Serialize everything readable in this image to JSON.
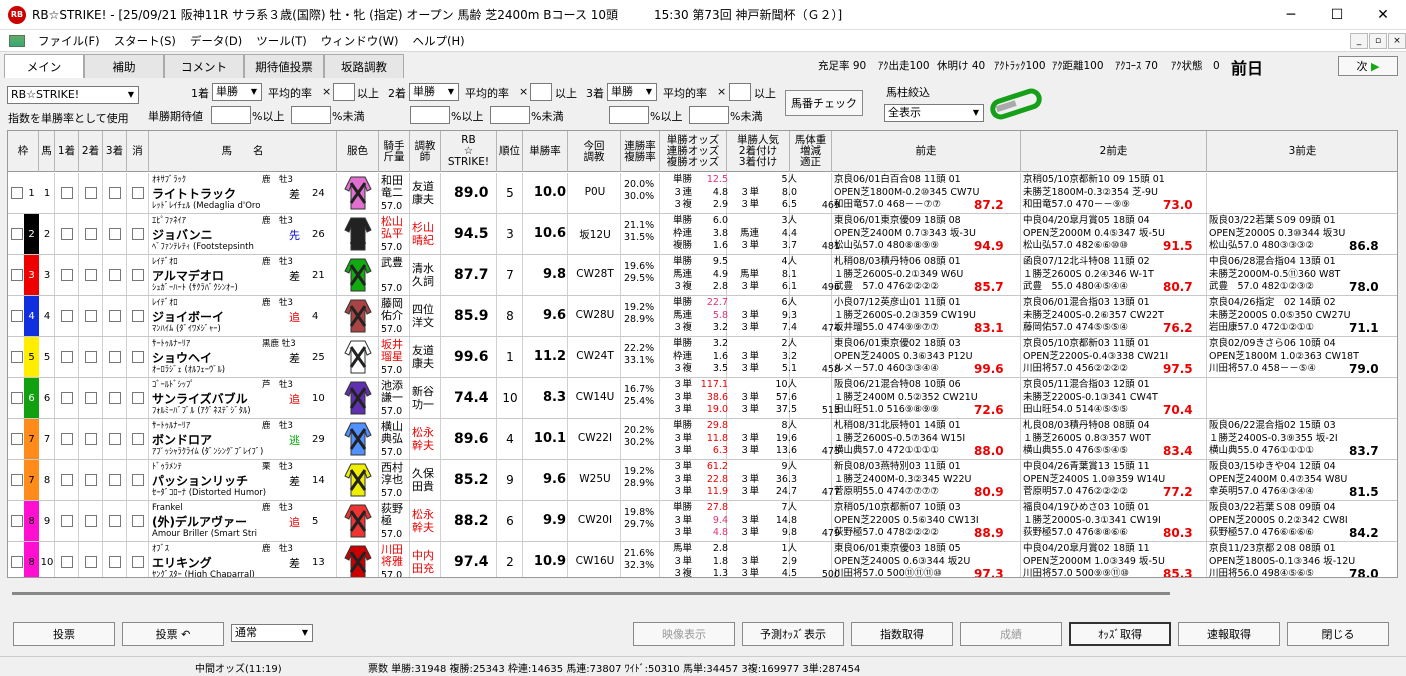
{
  "window": {
    "title": "RB☆STRIKE! - [25/09/21 阪神11R サラ系３歳(国際) 牡・牝 (指定) オープン 馬齢 芝2400m Bコース 10頭　　　15:30 第73回 神戸新聞杯（Ｇ２）]",
    "logo": "RB",
    "min": "─",
    "max": "☐",
    "close": "✕"
  },
  "menu": [
    "ファイル(F)",
    "スタート(S)",
    "データ(D)",
    "ツール(T)",
    "ウィンドウ(W)",
    "ヘルプ(H)"
  ],
  "mdi": [
    "_",
    "▫",
    "×"
  ],
  "tabs": [
    "メイン",
    "補助",
    "コメント",
    "期待値投票",
    "坂路調教"
  ],
  "stats": [
    "充足率 90",
    "ｱｸ出走100",
    "休明け 40",
    "ｱｸﾄﾗｯｸ100",
    "ｱｸ距離100",
    "ｱｸｺｰｽ 70",
    "ｱｸ状態　0"
  ],
  "today": "前日",
  "next": "次",
  "controls": {
    "index_select": "RB☆STRIKE!",
    "use_label": "指数を単勝率として使用",
    "first": "1着",
    "second": "2着",
    "third": "3着",
    "bet": "単勝",
    "avg": "平均的率",
    "mul": "×",
    "above": "以上",
    "pctAbove": "%以上",
    "pctBelow": "%未満",
    "expect": "単勝期待値",
    "baban": "馬番チェック",
    "filter_label": "馬柱絞込",
    "filter_value": "全表示"
  },
  "headers": [
    "枠",
    "馬",
    "1着",
    "2着",
    "3着",
    "消",
    "馬　　名",
    "服色",
    "騎手\n斤量",
    "調教\n師",
    "RB\n☆\nSTRIKE!",
    "順位",
    "単勝率",
    "今回\n調教",
    "連勝率\n複勝率",
    "単勝オッズ\n連勝オッズ\n複勝オッズ",
    "単勝人気\n2着付け\n3着付け",
    "馬体重\n増減\n適正",
    "前走",
    "2前走",
    "3前走"
  ],
  "horses": [
    {
      "waku": "1",
      "wc": "#fff",
      "wt": "#000",
      "no": "1",
      "sire": "ｵｷｻﾌﾞﾗｯｸ",
      "sex": "鹿　牡3",
      "name": "ライトトラック",
      "style": "差",
      "sc": "#000",
      "gate": "24",
      "dam": "ﾚｯﾄﾞﾚｲﾁｪﾙ (Medaglia d'Oro",
      "j1": "和田",
      "j2": "竜二",
      "jc": "#000",
      "w": "57.0",
      "t1": "友道",
      "t2": "康夫",
      "tc": "#000",
      "score": "89.0",
      "rank": "5",
      "win": "10.0",
      "train": "P0U",
      "r1": "20.0%",
      "r2": "30.0%",
      "o": [
        [
          "単勝",
          "12.5",
          "pink"
        ],
        [
          "３連",
          "4.8",
          ""
        ],
        [
          "３複",
          "2.9",
          ""
        ]
      ],
      "p": [
        [
          "",
          "5人"
        ],
        [
          "３単",
          "8.0"
        ],
        [
          "３単",
          "6.5"
        ]
      ],
      "bw": "469",
      "races": [
        [
          "京良06/01白百合08 11頭 01",
          "OPEN芝1800M-0.2⑩345 CW7U",
          "和田竜57.0 468－－⑦⑦ ",
          "87.2"
        ],
        [
          "京稍05/10京都新10 09 15頭 01",
          "未勝芝1800M-0.3②354 芝-9U",
          "和田竜57.0 470－－⑨⑨ ",
          "73.0"
        ],
        null
      ]
    },
    {
      "waku": "2",
      "wc": "#000",
      "wt": "#fff",
      "no": "2",
      "sire": "ｴﾋﾟﾌｧﾈｲｱ",
      "sex": "鹿　牡3",
      "name": "ジョバンニ",
      "style": "先",
      "sc": "#00c",
      "gate": "26",
      "dam": "ﾍﾞﾌｧﾝﾃﾚﾃｨ (Footstepsinth",
      "j1": "松山",
      "j2": "弘平",
      "jc": "#e00",
      "w": "57.0",
      "t1": "杉山",
      "t2": "晴紀",
      "tc": "#e00",
      "score": "94.5",
      "rank": "3",
      "win": "10.6",
      "train": "坂12U",
      "r1": "21.1%",
      "r2": "31.5%",
      "o": [
        [
          "単勝",
          "6.0",
          ""
        ],
        [
          "枠連",
          "3.8",
          ""
        ],
        [
          "複勝",
          "1.6",
          ""
        ]
      ],
      "p": [
        [
          "",
          "3人"
        ],
        [
          "馬連",
          "4.4"
        ],
        [
          "３単",
          "3.7"
        ]
      ],
      "bw": "481",
      "races": [
        [
          "東良06/01東京優09 18頭 08",
          "OPEN芝2400M 0.7③343 坂-3U",
          "松山弘57.0 480⑧⑧⑨⑨ ",
          "94.9"
        ],
        [
          "中良04/20皐月賞05 18頭 04",
          "OPEN芝2000M 0.4⑤347 坂-5U",
          "松山弘57.0 482⑥⑥⑩⑩ ",
          "91.5"
        ],
        [
          "阪良03/22若葉Ｓ09 09頭 01",
          "OPEN芝2000S 0.3⑩344 坂3U",
          "松山弘57.0 480③③③② ",
          "86.8"
        ]
      ]
    },
    {
      "waku": "3",
      "wc": "#e00",
      "wt": "#fff",
      "no": "3",
      "sire": "ﾚｲﾃﾞｵﾛ",
      "sex": "鹿　牡3",
      "name": "アルマデオロ",
      "style": "差",
      "sc": "#000",
      "gate": "21",
      "dam": "ｼｭｶﾞｰﾊｰﾄ (ｻｸﾗﾊﾞｸｼﾝｵｰ)",
      "j1": "武豊",
      "j2": "",
      "jc": "#000",
      "w": "57.0",
      "t1": "清水",
      "t2": "久詞",
      "tc": "#000",
      "score": "87.7",
      "rank": "7",
      "win": "9.8",
      "train": "CW28T",
      "r1": "19.6%",
      "r2": "29.5%",
      "o": [
        [
          "単勝",
          "9.5",
          ""
        ],
        [
          "馬連",
          "4.9",
          ""
        ],
        [
          "３複",
          "2.8",
          ""
        ]
      ],
      "p": [
        [
          "",
          "4人"
        ],
        [
          "馬単",
          "8.1"
        ],
        [
          "３単",
          "6.1"
        ]
      ],
      "bw": "496",
      "races": [
        [
          "札稍08/03積丹特06 08頭 01",
          "１勝芝2600S-0.2①349 W6U",
          "武豊　57.0 476②②②② ",
          "85.7"
        ],
        [
          "函良07/12北斗特08 11頭 02",
          "１勝芝2600S 0.2④346 W-1T",
          "武豊　55.0 480④⑤④④ ",
          "80.7"
        ],
        [
          "中良06/28混合指04 13頭 01",
          "未勝芝2000M-0.5⑪360 W8T",
          "武豊　57.0 482①②③② ",
          "78.0"
        ]
      ]
    },
    {
      "waku": "4",
      "wc": "#1030e0",
      "wt": "#fff",
      "no": "4",
      "sire": "ﾚｲﾃﾞｵﾛ",
      "sex": "鹿　牡3",
      "name": "ジョイボーイ",
      "style": "追",
      "sc": "#e00",
      "gate": "4",
      "dam": "ﾏﾝﾊｲﾑ (ﾀﾞｲﾜﾒｼﾞｬｰ)",
      "j1": "藤岡",
      "j2": "佑介",
      "jc": "#000",
      "w": "57.0",
      "t1": "四位",
      "t2": "洋文",
      "tc": "#000",
      "score": "85.9",
      "rank": "8",
      "win": "9.6",
      "train": "CW28U",
      "r1": "19.2%",
      "r2": "28.9%",
      "o": [
        [
          "単勝",
          "22.7",
          "pink"
        ],
        [
          "馬連",
          "5.8",
          "pink"
        ],
        [
          "３複",
          "3.2",
          ""
        ]
      ],
      "p": [
        [
          "",
          "6人"
        ],
        [
          "３単",
          "9.3"
        ],
        [
          "３単",
          "7.4"
        ]
      ],
      "bw": "474",
      "races": [
        [
          "小良07/12英彦山01 11頭 01",
          "１勝芝2600S-0.2③359 CW19U",
          "坂井瑠55.0 474⑨⑨⑦⑦ ",
          "83.1"
        ],
        [
          "京良06/01混合指03 13頭 01",
          "未勝芝2400S-0.2⑥357 CW22T",
          "藤岡佑57.0 474⑤⑤⑤④ ",
          "76.2"
        ],
        [
          "京良04/26指定　02 14頭 02",
          "未勝芝2000S 0.0⑤350 CW27U",
          "岩田康57.0 472①②①① ",
          "71.1"
        ]
      ]
    },
    {
      "waku": "5",
      "wc": "#ffee00",
      "wt": "#000",
      "no": "5",
      "sire": "ｻｰﾄｩﾙﾅｰﾘｱ",
      "sex": "黒鹿 牡3",
      "name": "ショウヘイ",
      "style": "差",
      "sc": "#000",
      "gate": "25",
      "dam": "ｵｰﾛﾗｼﾞｪ (ｵﾙﾌｪｰｳﾞﾙ)",
      "j1": "坂井",
      "j2": "瑠星",
      "jc": "#e00",
      "w": "57.0",
      "t1": "友道",
      "t2": "康夫",
      "tc": "#000",
      "score": "99.6",
      "rank": "1",
      "win": "11.2",
      "train": "CW24T",
      "r1": "22.2%",
      "r2": "33.1%",
      "o": [
        [
          "単勝",
          "3.2",
          ""
        ],
        [
          "枠連",
          "1.6",
          ""
        ],
        [
          "３複",
          "3.5",
          ""
        ]
      ],
      "p": [
        [
          "",
          "2人"
        ],
        [
          "３単",
          "3.2"
        ],
        [
          "３単",
          "5.1"
        ]
      ],
      "bw": "458",
      "races": [
        [
          "東良06/01東京優02 18頭 03",
          "OPEN芝2400S 0.3⑥343 P12U",
          "ルメ－57.0 460③③④④ ",
          "99.6"
        ],
        [
          "京良05/10京都新03 11頭 01",
          "OPEN芝2200S-0.4③338 CW21I",
          "川田将57.0 456②②②② ",
          "97.5"
        ],
        [
          "京良02/09きさら06 10頭 04",
          "OPEN芝1800M 1.0②363 CW18T",
          "川田将57.0 458－－⑤④ ",
          "79.0"
        ]
      ]
    },
    {
      "waku": "6",
      "wc": "#10a010",
      "wt": "#fff",
      "no": "6",
      "sire": "ｺﾞｰﾙﾄﾞｼｯﾌﾟ",
      "sex": "芦　牡3",
      "name": "サンライズバブル",
      "style": "追",
      "sc": "#e00",
      "gate": "10",
      "dam": "ﾌｫﾙﾐｰﾊﾞﾌﾞﾙ (ｱｸﾞﾈｽﾃﾞｼﾞﾀﾙ)",
      "j1": "池添",
      "j2": "謙一",
      "jc": "#000",
      "w": "57.0",
      "t1": "新谷",
      "t2": "功一",
      "tc": "#000",
      "score": "74.4",
      "rank": "10",
      "win": "8.3",
      "train": "CW14U",
      "r1": "16.7%",
      "r2": "25.4%",
      "o": [
        [
          "３単",
          "117.1",
          "red"
        ],
        [
          "３単",
          "38.6",
          "red"
        ],
        [
          "３単",
          "19.0",
          "red"
        ]
      ],
      "p": [
        [
          "",
          "10人"
        ],
        [
          "３単",
          "57.6"
        ],
        [
          "３単",
          "37.5"
        ]
      ],
      "bw": "513",
      "races": [
        [
          "阪良06/21混合特08 10頭 06",
          "１勝芝2400M 0.5②352 CW21U",
          "田山旺51.0 516⑨⑧⑨⑨ ",
          "72.6"
        ],
        [
          "京良05/11混合指03 12頭 01",
          "未勝芝2200S-0.1③341 CW4T",
          "田山旺54.0 514④⑤⑤⑤ ",
          "70.4"
        ],
        null
      ]
    },
    {
      "waku": "7",
      "wc": "#ff8c1a",
      "wt": "#000",
      "no": "7",
      "sire": "ｻｰﾄｩﾙﾅｰﾘｱ",
      "sex": "鹿　牡3",
      "name": "ボンドロア",
      "style": "逃",
      "sc": "#0a0",
      "gate": "29",
      "dam": "ｱﾌﾟｯｼｬﾗｸﾗｲﾑ (ﾀﾞﾝｼﾝｸﾞﾌﾞﾚｲﾌﾞ)",
      "j1": "横山",
      "j2": "典弘",
      "jc": "#000",
      "w": "57.0",
      "t1": "松永",
      "t2": "幹夫",
      "tc": "#e00",
      "score": "89.6",
      "rank": "4",
      "win": "10.1",
      "train": "CW22I",
      "r1": "20.2%",
      "r2": "30.2%",
      "o": [
        [
          "単勝",
          "29.8",
          "red"
        ],
        [
          "３単",
          "11.8",
          "red"
        ],
        [
          "３単",
          "6.3",
          "red"
        ]
      ],
      "p": [
        [
          "",
          "8人"
        ],
        [
          "３単",
          "19.6"
        ],
        [
          "３単",
          "13.6"
        ]
      ],
      "bw": "473",
      "races": [
        [
          "札稍08/31北辰特01 14頭 01",
          "１勝芝2600S-0.5⑦364 W15I",
          "横山典57.0 472①①①① ",
          "88.0"
        ],
        [
          "札良08/03積丹特08 08頭 04",
          "１勝芝2600S 0.8③357 W0T",
          "横山典55.0 476⑤⑤④⑤ ",
          "83.4"
        ],
        [
          "阪良06/22混合指02 15頭 03",
          "１勝芝2400S-0.3⑨355 坂-2I",
          "横山典55.0 476①①①① ",
          "83.7"
        ]
      ]
    },
    {
      "waku": "7",
      "wc": "#ff8c1a",
      "wt": "#000",
      "no": "8",
      "sire": "ﾄﾞｩﾗﾒﾝﾃ",
      "sex": "栗　牡3",
      "name": "パッションリッチ",
      "style": "差",
      "sc": "#000",
      "gate": "14",
      "dam": "ｾｰﾀﾞｺﾛｰﾅ (Distorted Humor)",
      "j1": "西村",
      "j2": "淳也",
      "jc": "#000",
      "w": "57.0",
      "t1": "久保",
      "t2": "田貴",
      "tc": "#000",
      "score": "85.2",
      "rank": "9",
      "win": "9.6",
      "train": "W25U",
      "r1": "19.2%",
      "r2": "28.9%",
      "o": [
        [
          "３単",
          "61.2",
          "red"
        ],
        [
          "３単",
          "22.8",
          "red"
        ],
        [
          "３単",
          "11.9",
          "red"
        ]
      ],
      "p": [
        [
          "",
          "9人"
        ],
        [
          "３単",
          "36.3"
        ],
        [
          "３単",
          "24.7"
        ]
      ],
      "bw": "477",
      "races": [
        [
          "新良08/03燕特別03 11頭 01",
          "１勝芝2400M-0.3②345 W22U",
          "菅原明55.0 474⑦⑦⑦⑦ ",
          "80.9"
        ],
        [
          "中良04/26青葉賞13 15頭 11",
          "OPEN芝2400S 1.0⑩359 W14U",
          "菅原明57.0 476②②②② ",
          "77.2"
        ],
        [
          "阪良03/15ゆきや04 12頭 04",
          "OPEN芝2400M 0.4⑦354 W8U",
          "幸英明57.0 476④③④④ ",
          "81.5"
        ]
      ]
    },
    {
      "waku": "8",
      "wc": "#ff10d0",
      "wt": "#000",
      "no": "9",
      "sire": "Frankel",
      "sex": "鹿　牡3",
      "name": "(外)デルアヴァー",
      "style": "追",
      "sc": "#e00",
      "gate": "5",
      "dam": "Amour Briller (Smart Stri",
      "j1": "荻野",
      "j2": "極",
      "jc": "#000",
      "w": "57.0",
      "t1": "松永",
      "t2": "幹夫",
      "tc": "#e00",
      "score": "88.2",
      "rank": "6",
      "win": "9.9",
      "train": "CW20I",
      "r1": "19.8%",
      "r2": "29.7%",
      "o": [
        [
          "単勝",
          "27.8",
          "red"
        ],
        [
          "３単",
          "9.4",
          "pink"
        ],
        [
          "３単",
          "4.8",
          "pink"
        ]
      ],
      "p": [
        [
          "",
          "7人"
        ],
        [
          "３単",
          "14.8"
        ],
        [
          "３単",
          "9.8"
        ]
      ],
      "bw": "479",
      "races": [
        [
          "京稍05/10京都新07 10頭 03",
          "OPEN芝2200S 0.5⑥340 CW13I",
          "荻野極57.0 478②②②② ",
          "88.9"
        ],
        [
          "福良04/19ひめさ03 10頭 01",
          "１勝芝2000S-0.3①341 CW19I",
          "荻野極57.0 476⑧⑧⑥⑥ ",
          "80.3"
        ],
        [
          "阪良03/22若葉Ｓ08 09頭 04",
          "OPEN芝2000S 0.2②342 CW8I",
          "荻野極57.0 476⑥⑥⑥⑥ ",
          "84.2"
        ]
      ]
    },
    {
      "waku": "8",
      "wc": "#ff10d0",
      "wt": "#000",
      "no": "10",
      "sire": "ｵﾌﾞｽ",
      "sex": "鹿　牡3",
      "name": "エリキング",
      "style": "差",
      "sc": "#000",
      "gate": "13",
      "dam": "ﾔﾝｸﾞｽﾀｰ (High Chaparral)",
      "j1": "川田",
      "j2": "将雅",
      "jc": "#e00",
      "w": "57.0",
      "t1": "中内",
      "t2": "田充",
      "tc": "#e00",
      "score": "97.4",
      "rank": "2",
      "win": "10.9",
      "train": "CW16U",
      "r1": "21.6%",
      "r2": "32.3%",
      "o": [
        [
          "馬単",
          "2.8",
          ""
        ],
        [
          "３単",
          "1.8",
          ""
        ],
        [
          "３複",
          "1.3",
          ""
        ]
      ],
      "p": [
        [
          "",
          "1人"
        ],
        [
          "３単",
          "2.9"
        ],
        [
          "３単",
          "4.5"
        ]
      ],
      "bw": "500",
      "races": [
        [
          "東良06/01東京優03 18頭 05",
          "OPEN芝2400S 0.6③344 坂2U",
          "川田将57.0 500⑪⑪⑪⑩ ",
          "97.3"
        ],
        [
          "中良04/20皐月賞02 18頭 11",
          "OPEN芝2000M 1.0③349 坂-5U",
          "川田将57.0 500⑨⑨⑪⑩ ",
          "85.3"
        ],
        [
          "京良11/23京都２08 08頭 01",
          "OPEN芝1800S-0.1③346 坂-12U",
          "川田将56.0 498④⑤⑥⑤ ",
          "78.0"
        ]
      ]
    }
  ],
  "bottom": {
    "vote": "投票",
    "vote2": "投票",
    "normal": "通常",
    "video": "映像表示",
    "predOdds": "予測ｵｯｽﾞ表示",
    "idxGet": "指数取得",
    "result": "成績",
    "oddsGet": "ｵｯｽﾞ取得",
    "fast": "速報取得",
    "close": "閉じる"
  },
  "status": [
    "中間オッズ(11:19)",
    "票数 単勝:31948 複勝:25343 枠連:14635 馬連:73807 ﾜｲﾄﾞ:50310 馬単:34457 3複:169977 3単:287454"
  ]
}
